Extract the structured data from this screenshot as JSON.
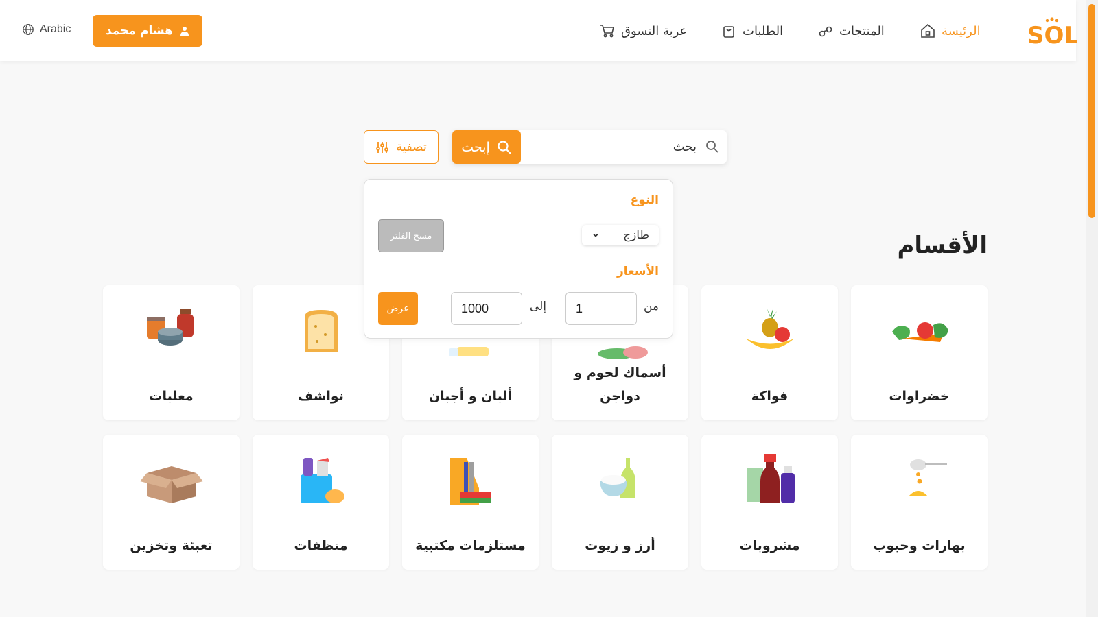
{
  "header": {
    "logo_text": "SOL",
    "nav": [
      {
        "label": "الرئيسة",
        "icon": "home-icon",
        "active": true
      },
      {
        "label": "المنتجات",
        "icon": "products-icon",
        "active": false
      },
      {
        "label": "الطلبات",
        "icon": "orders-bag-icon",
        "active": false
      },
      {
        "label": "عربة التسوق",
        "icon": "cart-icon",
        "active": false
      }
    ],
    "user_name": "هشام محمد",
    "language": "Arabic"
  },
  "search": {
    "placeholder": "بحث",
    "button_label": "إبحث",
    "filter_label": "تصفية"
  },
  "filter_panel": {
    "type_label": "النوع",
    "type_value": "طازج",
    "clear_label": "مسح الفلتر",
    "price_label": "الأسعار",
    "from_label": "من",
    "to_label": "إلى",
    "from_value": "1",
    "to_value": "1000",
    "show_label": "عرض"
  },
  "categories_title": "الأقسام",
  "categories": [
    {
      "label": "خضراوات",
      "icon": "vegetables-icon"
    },
    {
      "label": "فواكة",
      "icon": "fruits-icon"
    },
    {
      "label": "أسماك لحوم و دواجن",
      "icon": "meat-fish-icon"
    },
    {
      "label": "ألبان و أجبان",
      "icon": "dairy-icon"
    },
    {
      "label": "نواشف",
      "icon": "bread-icon"
    },
    {
      "label": "معلبات",
      "icon": "canned-food-icon"
    },
    {
      "label": "بهارات وحبوب",
      "icon": "spices-icon"
    },
    {
      "label": "مشروبات",
      "icon": "drinks-icon"
    },
    {
      "label": "أرز و زيوت",
      "icon": "rice-oil-icon"
    },
    {
      "label": "مستلزمات مكتبية",
      "icon": "office-supplies-icon"
    },
    {
      "label": "منظفات",
      "icon": "cleaners-icon"
    },
    {
      "label": "تعبئة وتخزين",
      "icon": "box-icon"
    }
  ],
  "colors": {
    "accent": "#f7941d",
    "background": "#f8f8f8",
    "card": "#ffffff"
  }
}
